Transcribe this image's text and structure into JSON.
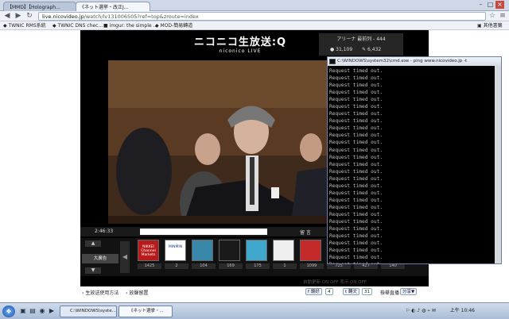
{
  "browser": {
    "tabs": [
      {
        "label": "【MMD】【Holograph..."
      },
      {
        "label": "《ネット選挙・改正J..."
      }
    ],
    "url_prefix": "live.nicovideo.jp",
    "url_rest": "/watch/lv131006505?ref=top&zroute=index",
    "bookmarks": [
      {
        "label": "TWNIC RMS系統"
      },
      {
        "label": "TWNIC DNS chec..."
      },
      {
        "label": "imgur: the simple ..."
      },
      {
        "label": "MOD-簡易轉道"
      }
    ],
    "other_bookmarks": "其他書籤"
  },
  "player": {
    "logo_main": "ニコニコ生放送:Q",
    "logo_sub": "niconico LIVE",
    "arena_title": "アリーナ 最前列 - 444",
    "viewers": "31,109",
    "comments": "6,432",
    "time": "2:46:33",
    "comment_button": "留 言",
    "big_ad_label": "大廣告",
    "thumbs": [
      {
        "label": "NIKKEI Channel Markets",
        "count": "1425",
        "color": "#b71b1b"
      },
      {
        "label": "MINMIN",
        "count": "2",
        "color": "#ffffff"
      },
      {
        "label": "",
        "count": "104",
        "color": "#3a88a9"
      },
      {
        "label": "",
        "count": "169",
        "color": "#1a1a1a"
      },
      {
        "label": "",
        "count": "175",
        "color": "#3fa6cc"
      },
      {
        "label": "",
        "count": "1",
        "color": "#efefef"
      },
      {
        "label": "",
        "count": "1099",
        "color": "#c42a2a"
      },
      {
        "label": "",
        "count": "725",
        "color": "#1c1c1c"
      },
      {
        "label": "",
        "count": "427",
        "color": "#1c1c1c"
      },
      {
        "label": "",
        "count": "140",
        "color": "#1c1c1c"
      }
    ],
    "toggles": "自動更新 ON OFF   表示 ON OFF"
  },
  "footer": {
    "link1": "生放送使用方法",
    "link2": "放聲留置",
    "fb_label": "讚好",
    "fb_count": "4",
    "share_label": "轉文",
    "share_count": "31",
    "link3": "檢舉直播",
    "share_btn": "分享▼"
  },
  "cmd": {
    "title": "C:\\WINDOWS\\system32\\cmd.exe - ping www.nicovideo.jp -t",
    "lines": "Request timed out.\nRequest timed out.\nRequest timed out.\nRequest timed out.\nRequest timed out.\nRequest timed out.\nRequest timed out.\nRequest timed out.\nRequest timed out.\nRequest timed out.\nRequest timed out.\nRequest timed out.\nRequest timed out.\nRequest timed out.\nRequest timed out.\nRequest timed out.\nRequest timed out.\nRequest timed out.\nRequest timed out.\nRequest timed out.\nRequest timed out.\nRequest timed out.\nRequest timed out.\nRequest timed out.\nRequest timed out.\nRequest timed out.\nRequest timed out.\nRequest timed out."
  },
  "taskbar": {
    "task1": "C:\\WINDOWS\\syste...",
    "task2": "《ネット選挙・...",
    "clock": "上午 10:46"
  }
}
